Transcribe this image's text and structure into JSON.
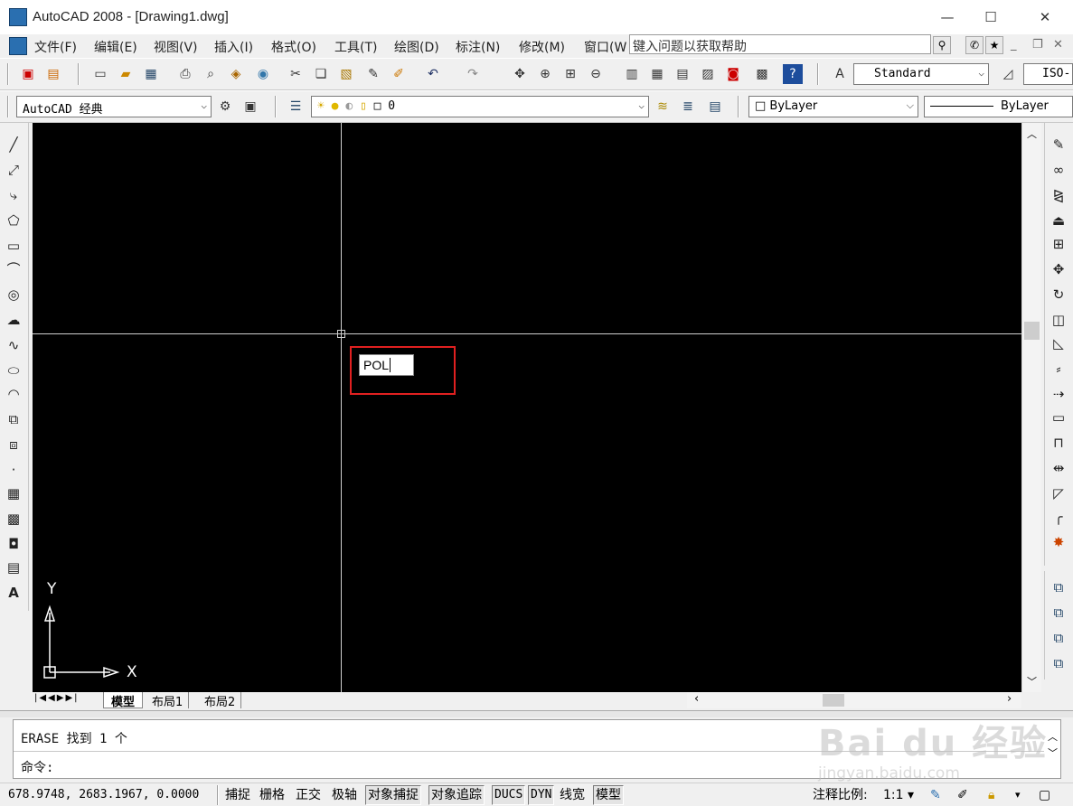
{
  "window": {
    "title": "AutoCAD 2008 - [Drawing1.dwg]",
    "minimize_glyph": "—",
    "maximize_glyph": "☐",
    "close_glyph": "✕"
  },
  "menu": {
    "items": [
      "文件(F)",
      "编辑(E)",
      "视图(V)",
      "插入(I)",
      "格式(O)",
      "工具(T)",
      "绘图(D)",
      "标注(N)",
      "修改(M)",
      "窗口(W"
    ],
    "help_placeholder": "键入问题以获取帮助"
  },
  "toolbar": {
    "text_style": "Standard",
    "dim_style_partial": "ISO-",
    "workspace": "AutoCAD 经典",
    "layer": "0",
    "color": "ByLayer",
    "linetype": "ByLayer"
  },
  "canvas": {
    "dynamic_input": "POL",
    "ucs_x": "X",
    "ucs_y": "Y",
    "background": "#000000",
    "highlight_color": "#e02020"
  },
  "tabs": [
    "模型",
    "布局1",
    "布局2"
  ],
  "command": {
    "history": "ERASE 找到 1 个",
    "prompt": "命令:"
  },
  "status": {
    "coordinates": "678.9748,  2683.1967, 0.0000",
    "toggles": [
      "捕捉",
      "栅格",
      "正交",
      "极轴",
      "对象捕捉",
      "对象追踪",
      "DUCS",
      "DYN",
      "线宽",
      "模型"
    ],
    "annotation_scale_label": "注释比例:",
    "annotation_scale_value": "1:1"
  },
  "watermark": {
    "brand": "Bai du 经验",
    "url": "jingyan.baidu.com"
  }
}
